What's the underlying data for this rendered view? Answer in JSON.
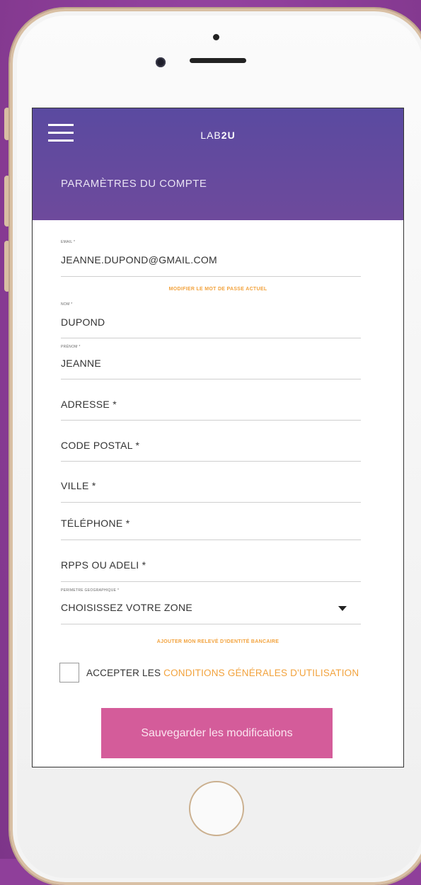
{
  "app": {
    "brand_prefix": "LAB",
    "brand_suffix": "2U",
    "page_title": "PARAMÈTRES DU COMPTE"
  },
  "form": {
    "email": {
      "label": "EMAIL *",
      "value": "JEANNE.DUPOND@GMAIL.COM"
    },
    "change_password_link": "MODIFIER LE MOT DE PASSE ACTUEL",
    "nom": {
      "label": "NOM *",
      "value": "DUPOND"
    },
    "prenom": {
      "label": "PRÉNOM *",
      "value": "JEANNE"
    },
    "adresse": {
      "placeholder": "ADRESSE *"
    },
    "code_postal": {
      "placeholder": "CODE POSTAL *"
    },
    "ville": {
      "placeholder": "VILLE *"
    },
    "telephone": {
      "placeholder": "TÉLÉPHONE *"
    },
    "rpps": {
      "placeholder": "RPPS OU ADELI *"
    },
    "zone": {
      "label": "PERIMETRE GEOGRAPHIQUE *",
      "value": "CHOISISSEZ VOTRE ZONE"
    },
    "rib_link": "AJOUTER MON RELEVÉ D'IDENTITÉ BANCAIRE",
    "cgu_prefix": "ACCEPTER LES ",
    "cgu_link": "CONDITIONS GÉNÉRALES D'UTILISATION",
    "cgu_checked": false,
    "save_label": "Sauvegarder les modifications"
  },
  "colors": {
    "header": "#5a4aa0",
    "accent_orange": "#f2a23c",
    "save_button": "#d45c9a",
    "background": "#8f3f9a"
  },
  "icons": [
    "hamburger-menu-icon",
    "dropdown-caret-icon",
    "home-button"
  ]
}
